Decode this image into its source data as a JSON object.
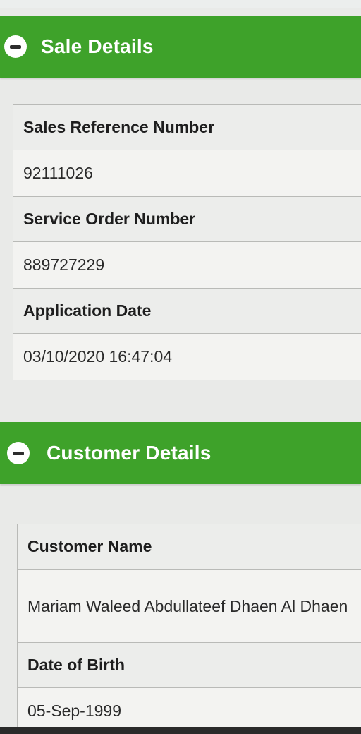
{
  "sale_details": {
    "title": "Sale Details",
    "fields": [
      {
        "label": "Sales Reference Number",
        "value": "92111026"
      },
      {
        "label": "Service Order Number",
        "value": "889727229"
      },
      {
        "label": "Application Date",
        "value": "03/10/2020 16:47:04"
      }
    ]
  },
  "customer_details": {
    "title": "Customer Details",
    "fields": [
      {
        "label": "Customer Name",
        "value": "Mariam Waleed Abdullateef Dhaen Al Dhaen"
      },
      {
        "label": "Date of Birth",
        "value": "05-Sep-1999"
      }
    ]
  },
  "colors": {
    "header_green": "#3ea22a",
    "header_text": "#ffffff",
    "background": "#e9eae8"
  },
  "icons": {
    "section_toggle": "collapse-minus-icon"
  }
}
